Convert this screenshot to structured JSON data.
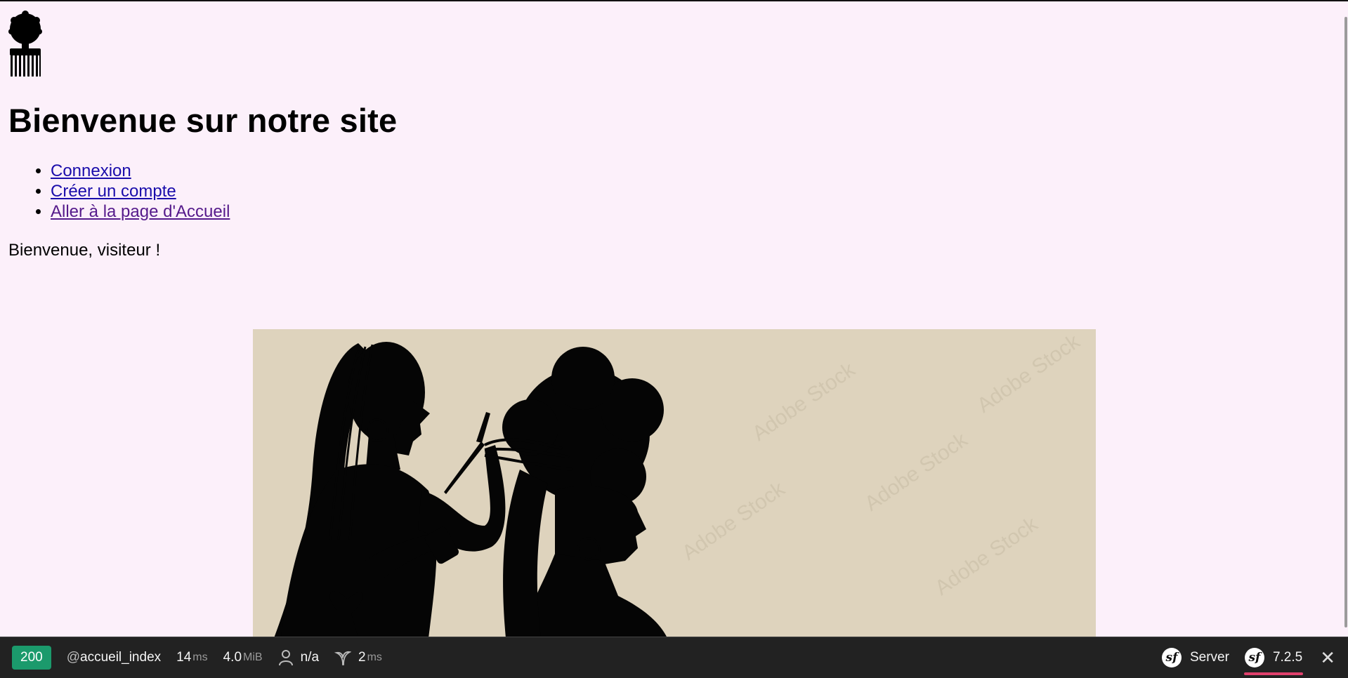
{
  "page": {
    "logo_name": "afro-comb-logo",
    "heading": "Bienvenue sur notre site",
    "nav": [
      {
        "label": "Connexion"
      },
      {
        "label": "Créer un compte"
      },
      {
        "label": "Aller à la page d'Accueil"
      }
    ],
    "welcome": "Bienvenue, visiteur !",
    "hero_image": "braiding-silhouette-illustration",
    "hero_bg_color": "#ded3bd",
    "background_color": "#fcf0fa",
    "link_color": "#1a0dab",
    "visited_link_color": "#551a8b"
  },
  "toolbar": {
    "status_code": "200",
    "route_prefix": "@",
    "route": "accueil_index",
    "time_value": "14",
    "time_unit": "ms",
    "memory_value": "4.0",
    "memory_unit": "MiB",
    "user": "n/a",
    "twig_time_value": "2",
    "twig_time_unit": "ms",
    "server_label": "Server",
    "version": "7.2.5",
    "status_color": "#1b9a6c",
    "accent_color": "#e0416d"
  }
}
